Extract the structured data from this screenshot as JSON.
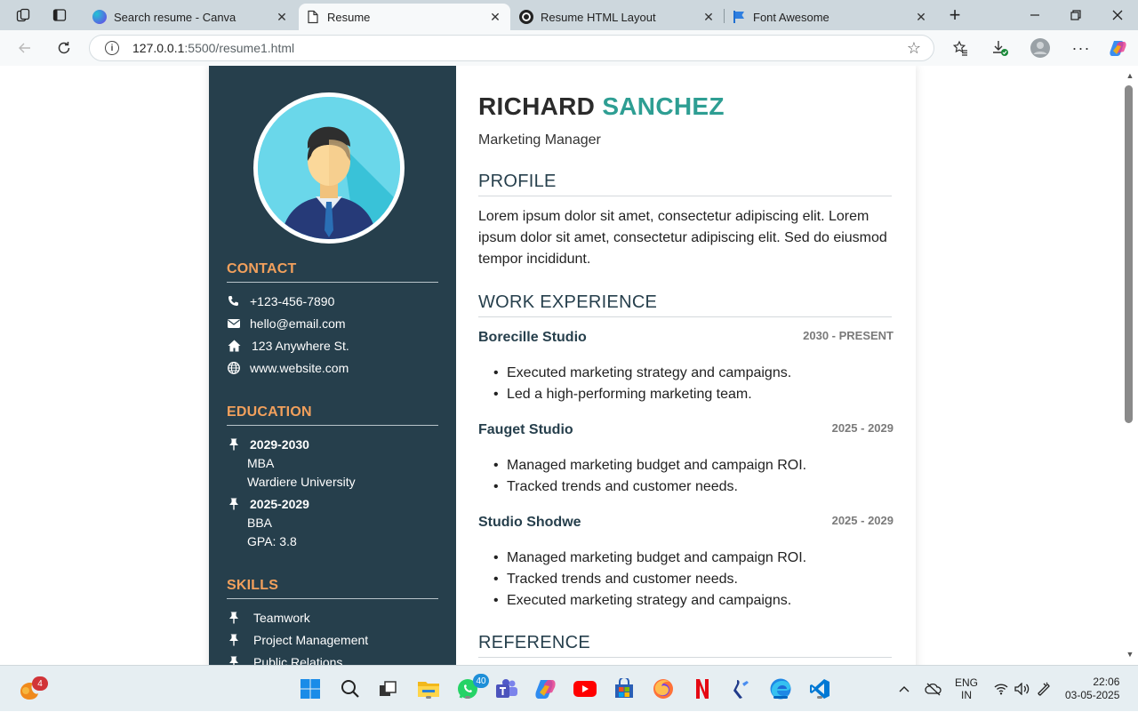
{
  "browser": {
    "tabs": [
      {
        "title": "Search resume - Canva",
        "active": false
      },
      {
        "title": "Resume",
        "active": true
      },
      {
        "title": "Resume HTML Layout",
        "active": false
      },
      {
        "title": "Font Awesome",
        "active": false
      }
    ],
    "address": {
      "host": "127.0.0.1",
      "path": ":5500/resume1.html"
    },
    "icons": [
      "workspaces-icon",
      "tab-actions-icon",
      "new-tab-icon",
      "minimize-icon",
      "restore-icon",
      "close-icon",
      "back-icon",
      "reload-icon",
      "info-icon",
      "favorite-star-icon",
      "favorites-icon",
      "downloads-icon",
      "profile-icon",
      "more-icon",
      "copilot-icon"
    ]
  },
  "resume": {
    "first_name": "RICHARD",
    "last_name": "SANCHEZ",
    "role": "Marketing Manager",
    "contact": {
      "heading": "CONTACT",
      "phone": "+123-456-7890",
      "email": "hello@email.com",
      "address": "123 Anywhere St.",
      "website": "www.website.com"
    },
    "education": {
      "heading": "EDUCATION",
      "items": [
        {
          "years": "2029-2030",
          "degree": "MBA",
          "detail": "Wardiere University"
        },
        {
          "years": "2025-2029",
          "degree": "BBA",
          "detail": "GPA: 3.8"
        }
      ]
    },
    "skills": {
      "heading": "SKILLS",
      "items": [
        "Teamwork",
        "Project Management",
        "Public Relations"
      ]
    },
    "profile": {
      "heading": "PROFILE",
      "text": "Lorem ipsum dolor sit amet, consectetur adipiscing elit. Lorem ipsum dolor sit amet, consectetur adipiscing elit. Sed do eiusmod tempor incididunt."
    },
    "experience": {
      "heading": "WORK EXPERIENCE",
      "jobs": [
        {
          "company": "Borecille Studio",
          "dates": "2030 - PRESENT",
          "bullets": [
            "Executed marketing strategy and campaigns.",
            "Led a high-performing marketing team."
          ]
        },
        {
          "company": "Fauget Studio",
          "dates": "2025 - 2029",
          "bullets": [
            "Managed marketing budget and campaign ROI.",
            "Tracked trends and customer needs."
          ]
        },
        {
          "company": "Studio Shodwe",
          "dates": "2025 - 2029",
          "bullets": [
            "Managed marketing budget and campaign ROI.",
            "Tracked trends and customer needs.",
            "Executed marketing strategy and campaigns."
          ]
        }
      ]
    },
    "reference": {
      "heading": "REFERENCE"
    }
  },
  "taskbar": {
    "badges": {
      "widgets": "4",
      "whatsapp": "40"
    },
    "lang": {
      "line1": "ENG",
      "line2": "IN"
    },
    "clock": {
      "time": "22:06",
      "date": "03-05-2025"
    }
  },
  "colors": {
    "sidebar_bg": "#263f4c",
    "accent_orange": "#f2a05c",
    "accent_teal": "#2e9e93"
  }
}
